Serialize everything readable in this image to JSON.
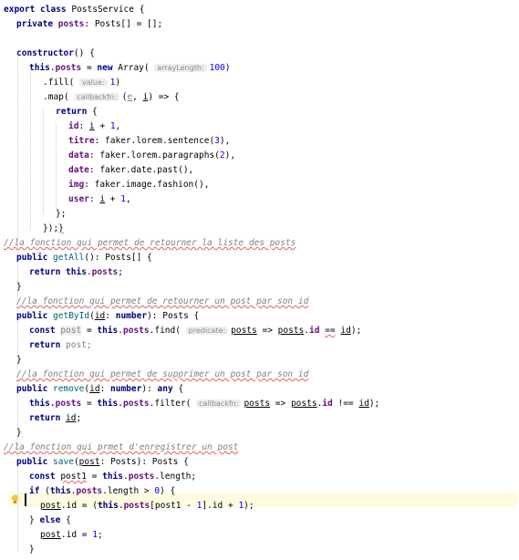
{
  "code": {
    "l1": {
      "a": "export class ",
      "b": "PostsService {"
    },
    "l2": {
      "a": "private ",
      "b": "posts",
      "c": ": Posts[] = [];"
    },
    "l3": {
      "a": "constructor",
      "b": "() {"
    },
    "l4": {
      "a": "this",
      "b": ".",
      "c": "posts",
      "d": " = ",
      "e": "new ",
      "f": "Array( ",
      "hint": "arrayLength:",
      "g": "100",
      "h": ")"
    },
    "l5": {
      "a": ".fill( ",
      "hint": "value:",
      "b": "1",
      "c": ")"
    },
    "l6": {
      "a": ".map( ",
      "hint": "callbackfn:",
      "b": "(",
      "c": "e",
      "d": ", ",
      "e": "i",
      "f": ") => {"
    },
    "l7": {
      "a": "return",
      "b": " {"
    },
    "l8": {
      "a": "id",
      "b": ": ",
      "c": "i",
      "d": " + ",
      "e": "1",
      "f": ","
    },
    "l9": {
      "a": "titre",
      "b": ": faker.lorem.sentence(",
      "c": "3",
      "d": "),"
    },
    "l10": {
      "a": "data",
      "b": ": faker.lorem.paragraphs(",
      "c": "2",
      "d": "),"
    },
    "l11": {
      "a": "date",
      "b": ": faker.date.past(),"
    },
    "l12": {
      "a": "img",
      "b": ": faker.image.fashion(),"
    },
    "l13": {
      "a": "user",
      "b": ": ",
      "c": "i",
      "d": " + ",
      "e": "1",
      "f": ","
    },
    "l14": "};",
    "l15": {
      "a": "});",
      "b": "}"
    },
    "l16": "//la fonction qui permet de retourner la liste des posts",
    "l17": {
      "a": "public ",
      "b": "getAll",
      "c": "(): Posts[] {"
    },
    "l18": {
      "a": "return ",
      "b": "this",
      "c": ".",
      "d": "posts",
      "e": ";"
    },
    "l19": "}",
    "l20": "//la fonction qui permet de retourner un post par son id",
    "l21": {
      "a": "public ",
      "b": "getById",
      "c": "(",
      "d": "id",
      "e": ": ",
      "f": "number",
      "g": "): Posts {"
    },
    "l22": {
      "a": "const ",
      "b": "post",
      "c": " = ",
      "d": "this",
      "e": ".",
      "f": "posts",
      "g": ".find( ",
      "hint": "predicate:",
      "h": "posts",
      "i": " => ",
      "j": "posts",
      "k": ".",
      "l": "id",
      "m": " ",
      "n": "==",
      "o": " ",
      "p": "id",
      "q": ");"
    },
    "l23": {
      "a": "return ",
      "b": "post;"
    },
    "l24": "}",
    "l25": "//la fonction qui permet de supprimer un post par son id",
    "l26": {
      "a": "public ",
      "b": "remove",
      "c": "(",
      "d": "id",
      "e": ": ",
      "f": "number",
      "g": "): ",
      "h": "any",
      "i": " {"
    },
    "l27": {
      "a": "this",
      "b": ".posts",
      "c": " = ",
      "d": "this",
      "e": ".",
      "f": "posts",
      "g": ".filter( ",
      "hint": "callbackfn:",
      "h": "posts",
      "i": " => ",
      "j": "posts",
      "k": ".",
      "l": "id",
      "m": " !== ",
      "n": "id",
      "o": ");"
    },
    "l28": {
      "a": "return ",
      "b": "id",
      "c": ";"
    },
    "l29": "}",
    "l30": "//la fonction qui prmet d'enregistrer un post",
    "l31": {
      "a": "public ",
      "b": "save",
      "c": "(",
      "d": "post",
      "e": ": Posts): Posts {"
    },
    "l32": {
      "a": "const ",
      "b": "post1",
      "c": " = ",
      "d": "this",
      "e": ".",
      "f": "posts",
      "g": ".length;"
    },
    "l33": {
      "a": "if",
      "b": " (",
      "c": "this",
      "d": ".",
      "e": "posts",
      "f": ".length > ",
      "g": "0",
      "h": ") {"
    },
    "l34": {
      "a": "post",
      "b": ".id = (",
      "c": "this",
      "d": ".",
      "e": "posts",
      "f": "[post1 - ",
      "g": "1",
      "h": "].id + ",
      "i": "1",
      "j": ");"
    },
    "l35": {
      "a": "} ",
      "b": "else",
      "c": " {"
    },
    "l36": {
      "a": "post",
      "b": ".id = ",
      "c": "1",
      "d": ";"
    },
    "l37": "}"
  },
  "colors": {
    "keyword": "#000080",
    "field": "#660e7a",
    "number": "#0000ff",
    "comment": "#808080",
    "current_line": "#fffbe1"
  }
}
